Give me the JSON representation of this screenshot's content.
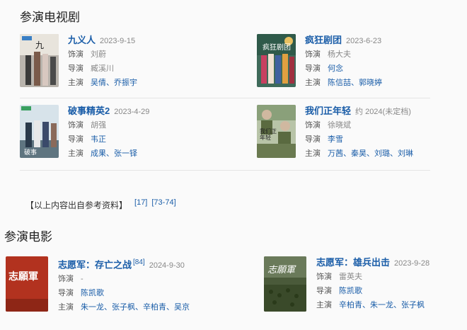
{
  "sections": {
    "tv_title": "参演电视剧",
    "movie_title": "参演电影"
  },
  "labels": {
    "role": "饰演",
    "director": "导演",
    "cast": "主演"
  },
  "tv": [
    {
      "title": "九义人",
      "date": "2023-9-15",
      "role": "刘蔚",
      "director": "臧溪川",
      "cast": [
        "吴倩",
        "乔振宇"
      ]
    },
    {
      "title": "疯狂剧团",
      "date": "2023-6-23",
      "role": "杨大夫",
      "director": "何念",
      "cast": [
        "陈信喆",
        "郭晓婷"
      ]
    },
    {
      "title": "破事精英2",
      "date": "2023-4-29",
      "role": "胡强",
      "director": "韦正",
      "cast": [
        "成果",
        "张一铎"
      ]
    },
    {
      "title": "我们正年轻",
      "date": "约 2024(未定档)",
      "role": "徐晓斌",
      "director": "李雪",
      "cast": [
        "万茜",
        "秦昊",
        "刘璐",
        "刘琳"
      ]
    }
  ],
  "note": {
    "text": "【以上内容出自参考资料】",
    "refs": [
      "[17]",
      "[73-74]"
    ]
  },
  "movies": [
    {
      "title": "志愿军：存亡之战",
      "ref": "[84]",
      "date": "2024-9-30",
      "role": "-",
      "director": "陈凯歌",
      "cast": [
        "朱一龙",
        "张子枫",
        "辛柏青",
        "吴京"
      ],
      "poster_text": "志願軍"
    },
    {
      "title": "志愿军：雄兵出击",
      "date": "2023-9-28",
      "role": "雷英夫",
      "director": "陈凯歌",
      "cast": [
        "辛柏青",
        "朱一龙",
        "张子枫"
      ],
      "poster_text": "志願軍"
    }
  ],
  "poster_texts": {
    "tv4": "我们正年轻"
  }
}
